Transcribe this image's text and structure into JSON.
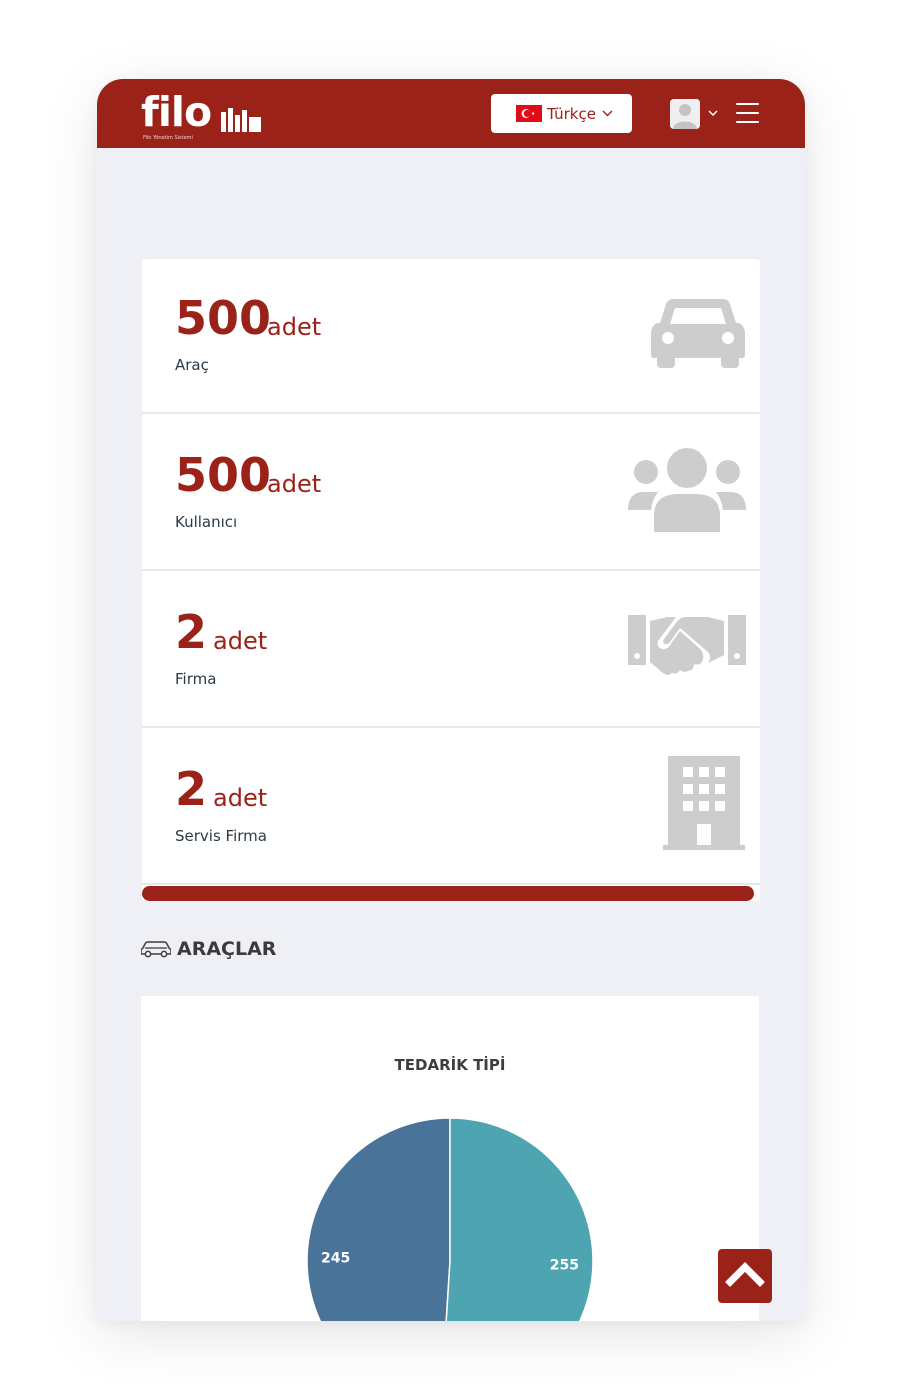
{
  "header": {
    "logo": "filo",
    "logo_tagline": "Filo Yönetim Sistemi",
    "language_label": "Türkçe",
    "brand_color": "#9b2219"
  },
  "stats": [
    {
      "value": "500",
      "unit": "adet",
      "label": "Araç",
      "icon": "car-icon"
    },
    {
      "value": "500",
      "unit": "adet",
      "label": "Kullanıcı",
      "icon": "users-icon"
    },
    {
      "value": "2",
      "unit": "adet",
      "label": "Firma",
      "icon": "handshake-icon"
    },
    {
      "value": "2",
      "unit": "adet",
      "label": "Servis Firma",
      "icon": "building-icon"
    }
  ],
  "section": {
    "title": "ARAÇLAR",
    "icon": "car-outline-icon"
  },
  "chart_data": {
    "type": "pie",
    "title": "TEDARİK TİPİ",
    "slices": [
      {
        "value": 245,
        "label": "245",
        "color": "#4a7399"
      },
      {
        "value": 255,
        "label": "255",
        "color": "#4ea4b1"
      }
    ]
  },
  "scroll_top": {
    "icon": "chevron-up-icon"
  }
}
